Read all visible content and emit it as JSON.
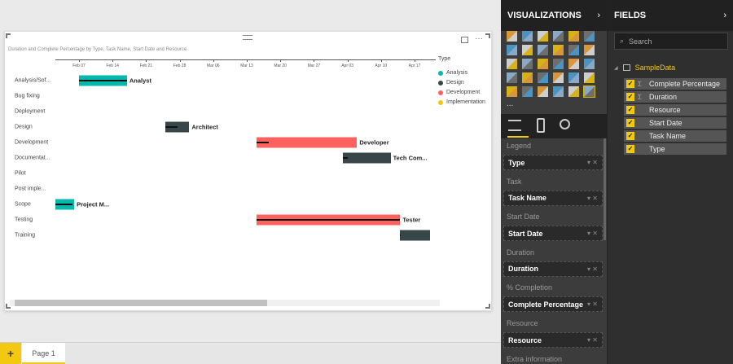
{
  "visual": {
    "title": "Duration and Complete Percentage by Type, Task Name, Start Date and Resource"
  },
  "chart_data": {
    "type": "gantt",
    "title": "Duration and Complete Percentage by Type, Task Name, Start Date and Resource",
    "x_ticks": [
      "Feb 07",
      "Feb 14",
      "Feb 21",
      "Feb 28",
      "Mar 06",
      "Mar 13",
      "Mar 20",
      "Mar 27",
      "Apr 03",
      "Apr 10",
      "Apr 17"
    ],
    "axis_start_day_offset": -5,
    "legend": {
      "title": "Type",
      "position": "top-right",
      "items": [
        {
          "name": "Analysis",
          "color": "#01b8aa"
        },
        {
          "name": "Design",
          "color": "#374649"
        },
        {
          "name": "Development",
          "color": "#fd625e"
        },
        {
          "name": "Implementation",
          "color": "#f2c80f"
        }
      ]
    },
    "tasks": [
      {
        "name": "Analysis/Sof...",
        "type": "Analysis",
        "start_day": 0,
        "duration": 10,
        "complete": 1.0,
        "resource": "Analyst"
      },
      {
        "name": "Bug fixing"
      },
      {
        "name": "Deployment"
      },
      {
        "name": "Design",
        "type": "Design",
        "start_day": 18,
        "duration": 5,
        "complete": 0.5,
        "resource": "Architect"
      },
      {
        "name": "Development",
        "type": "Development",
        "start_day": 37,
        "duration": 21,
        "complete": 0.12,
        "resource": "Developer"
      },
      {
        "name": "Documentat...",
        "type": "Design",
        "start_day": 55,
        "duration": 10,
        "complete": 0.1,
        "resource": "Tech Com..."
      },
      {
        "name": "Pilot"
      },
      {
        "name": "Post imple..."
      },
      {
        "name": "Scope",
        "type": "Analysis",
        "start_day": -5,
        "duration": 4,
        "complete": 0.9,
        "resource": "Project M..."
      },
      {
        "name": "Testing",
        "type": "Development",
        "start_day": 37,
        "duration": 30,
        "complete": 1.0,
        "resource": "Tester"
      },
      {
        "name": "Training",
        "type": "Design",
        "start_day": 67,
        "duration": 6.3,
        "complete": 0.02,
        "resource": ""
      }
    ]
  },
  "page_tabs": {
    "add": "+",
    "pages": [
      "Page 1"
    ]
  },
  "visualizations": {
    "title": "VISUALIZATIONS",
    "more": "...",
    "tabs": [
      "fields-tab",
      "format-tab",
      "analytics-tab"
    ],
    "wells": [
      {
        "label": "Legend",
        "value": "Type"
      },
      {
        "label": "Task",
        "value": "Task Name"
      },
      {
        "label": "Start Date",
        "value": "Start Date"
      },
      {
        "label": "Duration",
        "value": "Duration"
      },
      {
        "label": "% Completion",
        "value": "Complete Percentage"
      },
      {
        "label": "Resource",
        "value": "Resource"
      },
      {
        "label": "Extra information",
        "value": ""
      }
    ]
  },
  "fields": {
    "title": "FIELDS",
    "search_placeholder": "Search",
    "table": "SampleData",
    "items": [
      {
        "name": "Complete Percentage",
        "sigma": "Σ"
      },
      {
        "name": "Duration",
        "sigma": "Σ"
      },
      {
        "name": "Resource",
        "sigma": ""
      },
      {
        "name": "Start Date",
        "sigma": ""
      },
      {
        "name": "Task Name",
        "sigma": ""
      },
      {
        "name": "Type",
        "sigma": ""
      }
    ]
  }
}
